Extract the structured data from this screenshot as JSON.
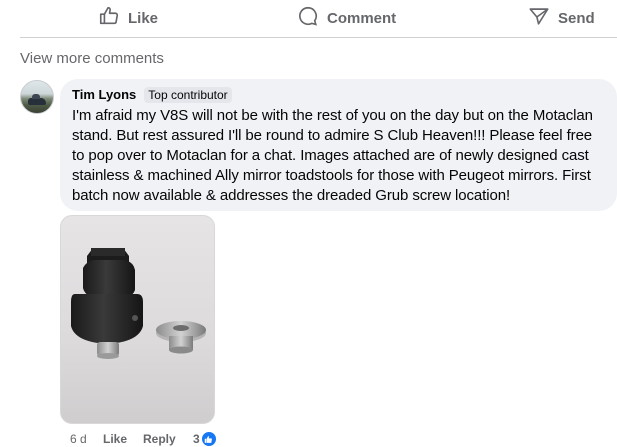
{
  "action_bar": {
    "like_label": "Like",
    "comment_label": "Comment",
    "send_label": "Send"
  },
  "view_more_label": "View more comments",
  "comment": {
    "author": "Tim Lyons",
    "badge": "Top contributor",
    "text": "I'm afraid my V8S will not be with the rest of you on the day but on the Motaclan stand. But rest assured I'll be round to admire S Club Heaven!!! Please feel free to pop over to Motaclan for a chat. Images attached are of newly designed cast stainless & machined Ally mirror toadstools for those with Peugeot mirrors. First batch now available & addresses the dreaded Grub screw location!",
    "photo_icon": "attached-photo-mirror-toadstools",
    "time": "6 d",
    "like_label": "Like",
    "reply_label": "Reply",
    "reaction_count": "3",
    "reaction_icon": "like-reaction-icon"
  },
  "colors": {
    "secondary_text": "#65676b",
    "bubble_bg": "#f0f2f5",
    "like_blue": "#1877f2"
  }
}
